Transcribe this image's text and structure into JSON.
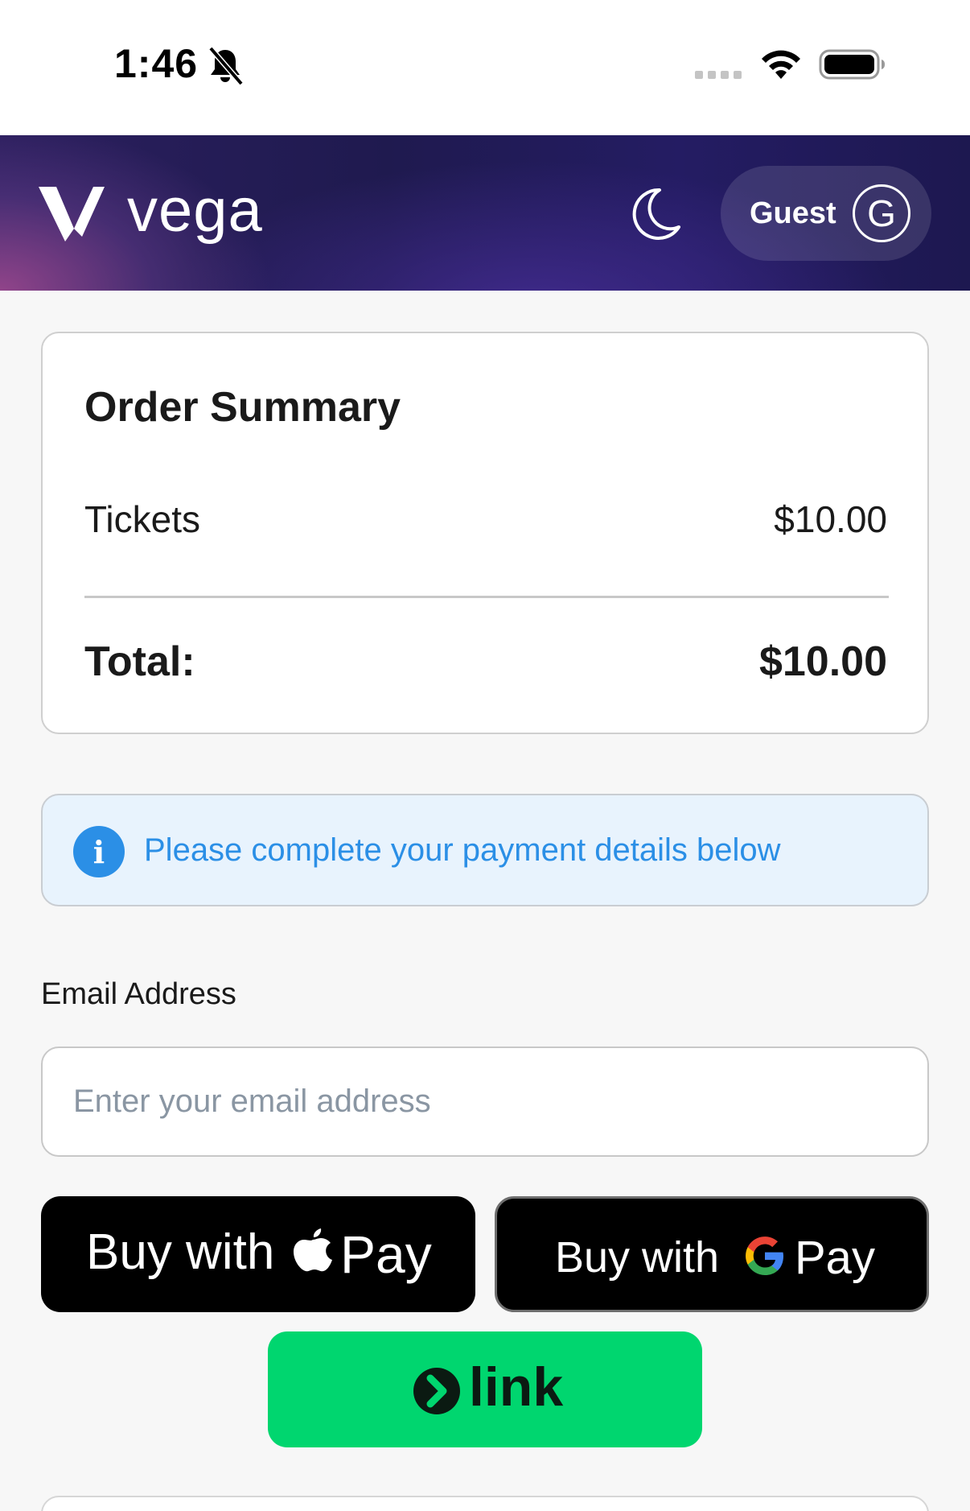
{
  "status_bar": {
    "time": "1:46"
  },
  "header": {
    "logo_text": "vega",
    "guest_label": "Guest",
    "avatar_initial": "G",
    "colors": {
      "gradient_start": "#8a3f80",
      "gradient_mid": "#2b1f5e",
      "gradient_end": "#1d1850"
    }
  },
  "order_summary": {
    "title": "Order Summary",
    "items": [
      {
        "label": "Tickets",
        "value": "$10.00"
      }
    ],
    "total_label": "Total:",
    "total_value": "$10.00"
  },
  "info_banner": {
    "icon": "info-icon",
    "icon_glyph": "i",
    "text": "Please complete your payment details below",
    "color": "#2b8fe6"
  },
  "email": {
    "label": "Email Address",
    "placeholder": "Enter your email address",
    "value": ""
  },
  "payment_buttons": {
    "apple_pay": {
      "prefix": "Buy with",
      "brand": "Pay"
    },
    "google_pay": {
      "prefix": "Buy with",
      "brand": "Pay"
    },
    "link": {
      "label": "link",
      "color": "#00d66f"
    }
  }
}
